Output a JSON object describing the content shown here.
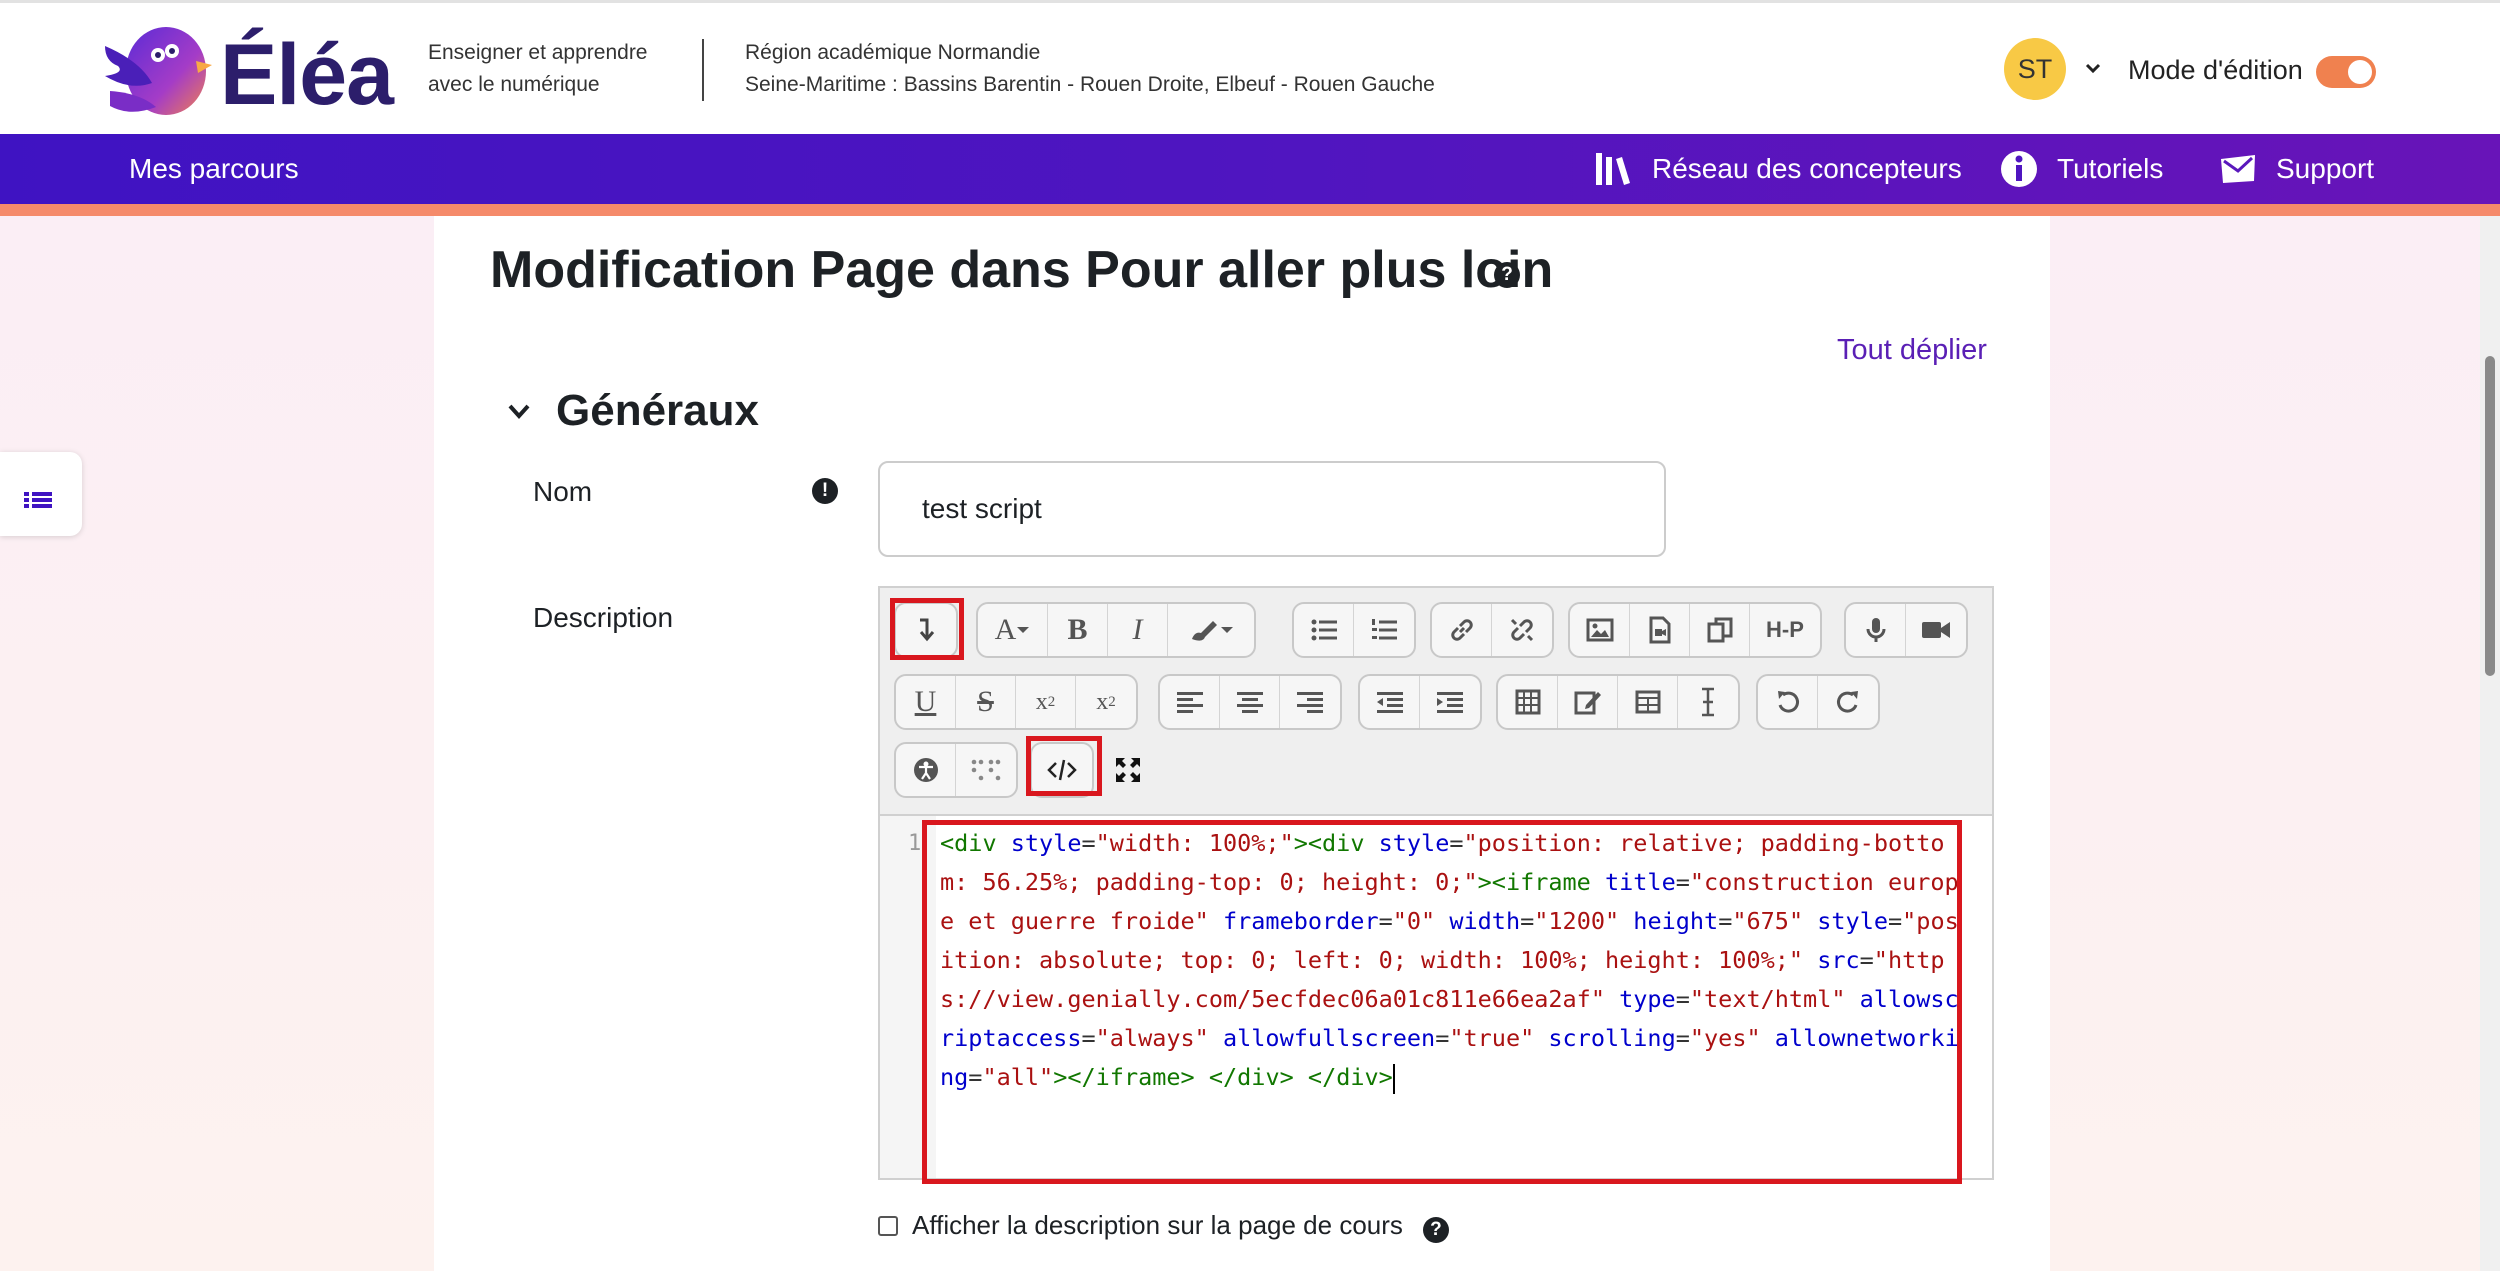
{
  "brand": {
    "name": "Éléa",
    "tagline_line1": "Enseigner et apprendre",
    "tagline_line2": "avec le numérique"
  },
  "region": {
    "line1": "Région académique Normandie",
    "line2": "Seine-Maritime : Bassins Barentin - Rouen Droite, Elbeuf - Rouen Gauche"
  },
  "user": {
    "initials": "ST",
    "mode_label": "Mode d'édition",
    "edit_mode_on": true
  },
  "nav": {
    "my_courses": "Mes parcours",
    "network": "Réseau des concepteurs",
    "tutorials": "Tutoriels",
    "support": "Support"
  },
  "page": {
    "title": "Modification Page dans Pour aller plus loin",
    "expand_all": "Tout déplier",
    "section_title": "Généraux"
  },
  "form": {
    "name_label": "Nom",
    "name_value": "test script",
    "description_label": "Description",
    "show_description_label": "Afficher la description sur la page de cours",
    "show_description_checked": false
  },
  "editor": {
    "line_number": "1",
    "code": "<div style=\"width: 100%;\"><div style=\"position: relative; padding-bottom: 56.25%; padding-top: 0; height: 0;\"><iframe title=\"construction europe et guerre froide\" frameborder=\"0\" width=\"1200\" height=\"675\" style=\"position: absolute; top: 0; left: 0; width: 100%; height: 100%;\" src=\"https://view.genially.com/5ecfdec06a01c811e66ea2af\" type=\"text/html\" allowscriptaccess=\"always\" allowfullscreen=\"true\" scrolling=\"yes\" allownetworking=\"all\"></iframe> </div> </div>",
    "toolbar": {
      "row1": [
        "collapse-toolbar",
        "font-style",
        "bold",
        "italic",
        "text-color",
        "unordered-list",
        "ordered-list",
        "link",
        "unlink",
        "image",
        "media",
        "manage-files",
        "h5p",
        "record-audio",
        "record-video"
      ],
      "row2": [
        "underline",
        "strikethrough",
        "subscript",
        "superscript",
        "align-left",
        "align-center",
        "align-right",
        "outdent",
        "indent",
        "table",
        "equation",
        "table-edit",
        "special-char",
        "undo",
        "redo"
      ],
      "row3": [
        "accessibility-checker",
        "screenreader-helper",
        "html-source",
        "fullscreen"
      ],
      "h5p_label": "H-P"
    },
    "highlighted_tools": [
      "collapse-toolbar",
      "html-source"
    ]
  },
  "colors": {
    "accent": "#5a1fb5",
    "nav_start": "#3f13c2",
    "nav_end": "#6814b8",
    "nav_stripe": "#f58a6a",
    "highlight": "#d9171e",
    "avatar": "#f8c945",
    "toggle": "#f0814f"
  }
}
